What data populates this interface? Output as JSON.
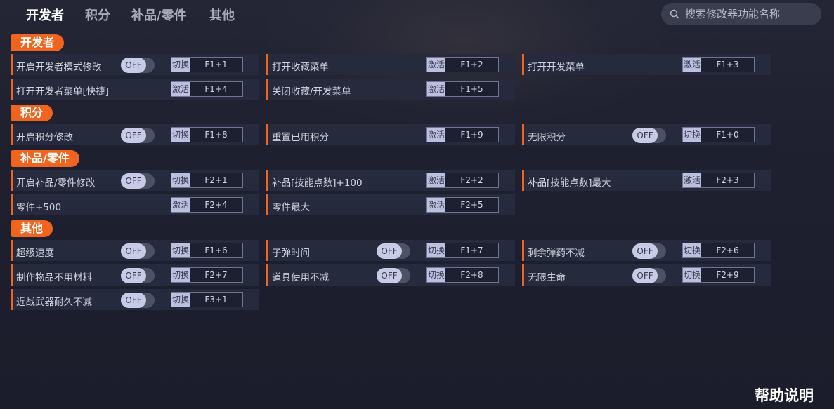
{
  "tabs": [
    "开发者",
    "积分",
    "补品/零件",
    "其他"
  ],
  "search": {
    "placeholder": "搜索修改器功能名称"
  },
  "sections": {
    "dev": "开发者",
    "points": "积分",
    "supply": "补品/零件",
    "other": "其他"
  },
  "toggle_off": "OFF",
  "rows": {
    "dev_mode": {
      "label": "开启开发者模式修改",
      "action": "切换",
      "key": "F1+1"
    },
    "open_fav": {
      "label": "打开收藏菜单",
      "action": "激活",
      "key": "F1+2"
    },
    "open_dev": {
      "label": "打开开发菜单",
      "action": "激活",
      "key": "F1+3"
    },
    "open_dev_quick": {
      "label": "打开开发者菜单[快捷]",
      "action": "激活",
      "key": "F1+4"
    },
    "close_fav_dev": {
      "label": "关闭收藏/开发菜单",
      "action": "激活",
      "key": "F1+5"
    },
    "points_mod": {
      "label": "开启积分修改",
      "action": "切换",
      "key": "F1+8"
    },
    "reset_points": {
      "label": "重置已用积分",
      "action": "激活",
      "key": "F1+9"
    },
    "infinite_points": {
      "label": "无限积分",
      "action": "切换",
      "key": "F1+0"
    },
    "supply_mod": {
      "label": "开启补品/零件修改",
      "action": "切换",
      "key": "F2+1"
    },
    "skill_plus100": {
      "label": "补品[技能点数]+100",
      "action": "激活",
      "key": "F2+2"
    },
    "skill_max": {
      "label": "补品[技能点数]最大",
      "action": "激活",
      "key": "F2+3"
    },
    "parts_plus500": {
      "label": "零件+500",
      "action": "激活",
      "key": "F2+4"
    },
    "parts_max": {
      "label": "零件最大",
      "action": "激活",
      "key": "F2+5"
    },
    "super_speed": {
      "label": "超级速度",
      "action": "切换",
      "key": "F1+6"
    },
    "bullet_time": {
      "label": "子弹时间",
      "action": "切换",
      "key": "F1+7"
    },
    "ammo_nodec": {
      "label": "剩余弹药不减",
      "action": "切换",
      "key": "F2+6"
    },
    "craft_nomat": {
      "label": "制作物品不用材料",
      "action": "切换",
      "key": "F2+7"
    },
    "items_nodec": {
      "label": "道具使用不减",
      "action": "切换",
      "key": "F2+8"
    },
    "infinite_life": {
      "label": "无限生命",
      "action": "切换",
      "key": "F2+9"
    },
    "melee_durability": {
      "label": "近战武器耐久不减",
      "action": "切换",
      "key": "F3+1"
    }
  },
  "help": "帮助说明",
  "colors": {
    "accent": "#f0641e",
    "background": "#1e2030",
    "row": "#262a3d"
  }
}
